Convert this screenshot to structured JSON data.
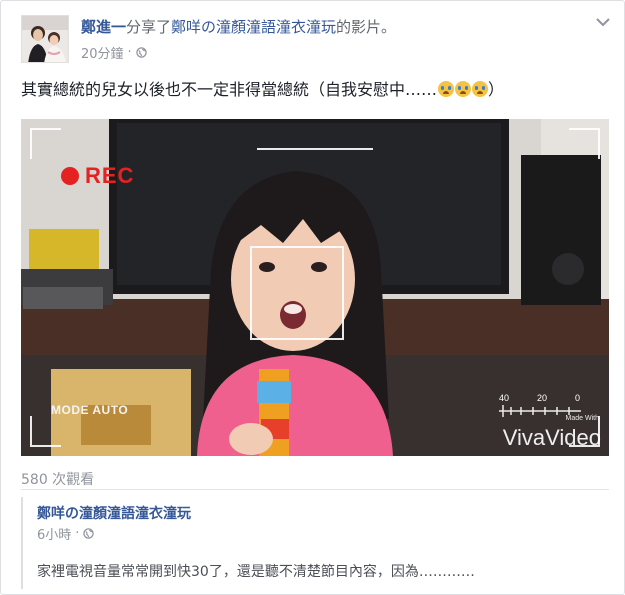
{
  "post": {
    "author": "鄭進一",
    "action": "分享了",
    "shared_page": "鄭咩の潼顏潼語潼衣潼玩",
    "action_suffix": "的影片。",
    "time": "20分鐘",
    "dot": "·",
    "text": "其實總統的兒女以後也不一定非得當總統（自我安慰中……",
    "text_end": "）",
    "emoji": [
      "loudly-crying-face",
      "loudly-crying-face",
      "loudly-crying-face"
    ]
  },
  "video": {
    "rec_label": "REC",
    "mode_label": "MODE AUTO",
    "scale_labels": [
      "40",
      "20",
      "0"
    ],
    "made_with": "Made With",
    "watermark": "VivaVideo",
    "rec_color": "#e52222"
  },
  "stats": {
    "views": "580 次觀看"
  },
  "shared_post": {
    "page_name": "鄭咩の潼顏潼語潼衣潼玩",
    "time": "6小時",
    "dot": "·",
    "text": "家裡電視音量常常開到快30了，還是聽不清楚節目內容，因為…………"
  },
  "colors": {
    "link": "#365899",
    "meta": "#90949c",
    "text": "#1d2129"
  }
}
